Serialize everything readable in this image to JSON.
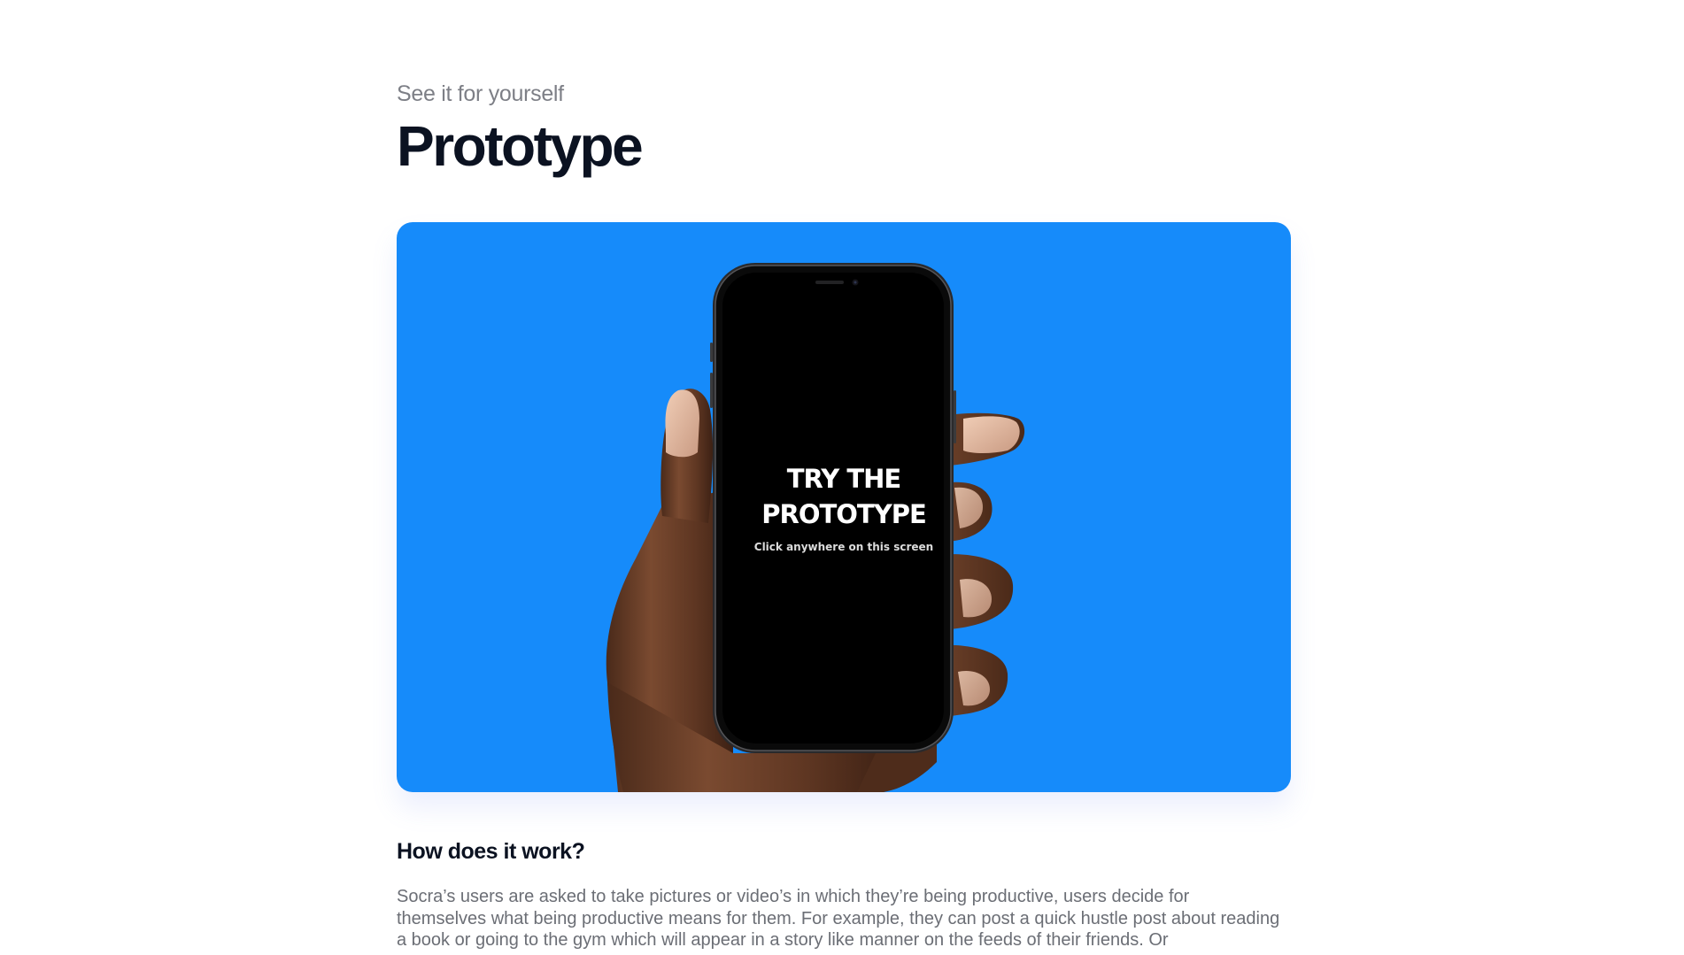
{
  "section": {
    "eyebrow": "See it for yourself",
    "title": "Prototype"
  },
  "hero": {
    "background_color": "#168bfa",
    "cta_title": "TRY THE PROTOTYPE",
    "cta_subtitle": "Click anywhere on this screen"
  },
  "how_it_works": {
    "heading": "How does it work?",
    "body": "Socra’s users are asked to take pictures or video’s in which they’re being productive, users decide for themselves what being productive means for them. For example, they can post a quick hustle post about reading a book or going to the gym which will appear in a story like manner on the feeds of their friends. Or"
  }
}
